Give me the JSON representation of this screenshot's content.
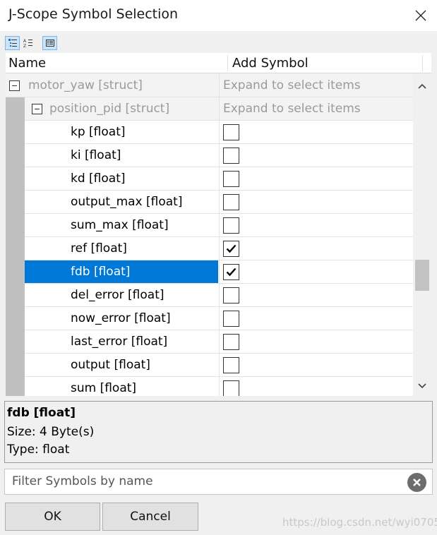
{
  "window": {
    "title": "J-Scope Symbol Selection"
  },
  "toolbar": {
    "buttons": [
      {
        "name": "categorized-view",
        "icon": "list-categorized-icon",
        "active": true
      },
      {
        "name": "sorted-view",
        "icon": "sort-az-icon",
        "active": false
      },
      {
        "name": "details-view",
        "icon": "details-pane-icon",
        "active": true
      }
    ]
  },
  "columns": {
    "name": "Name",
    "add": "Add Symbol"
  },
  "tree": {
    "rows": [
      {
        "label": "motor_yaw [struct]",
        "add_text": "Expand to select items",
        "expandable": true,
        "level": 0
      },
      {
        "label": "position_pid [struct]",
        "add_text": "Expand to select items",
        "expandable": true,
        "level": 1
      },
      {
        "label": "kp [float]",
        "checked": false,
        "level": 2
      },
      {
        "label": "ki [float]",
        "checked": false,
        "level": 2
      },
      {
        "label": "kd [float]",
        "checked": false,
        "level": 2
      },
      {
        "label": "output_max [float]",
        "checked": false,
        "level": 2
      },
      {
        "label": "sum_max [float]",
        "checked": false,
        "level": 2
      },
      {
        "label": "ref [float]",
        "checked": true,
        "level": 2
      },
      {
        "label": "fdb [float]",
        "checked": true,
        "level": 2,
        "selected": true
      },
      {
        "label": "del_error [float]",
        "checked": false,
        "level": 2
      },
      {
        "label": "now_error [float]",
        "checked": false,
        "level": 2
      },
      {
        "label": "last_error [float]",
        "checked": false,
        "level": 2
      },
      {
        "label": "output [float]",
        "checked": false,
        "level": 2
      },
      {
        "label": "sum [float]",
        "checked": false,
        "level": 2
      }
    ]
  },
  "info": {
    "title": "fdb [float]",
    "size": "Size:  4 Byte(s)",
    "type": "Type:  float"
  },
  "filter": {
    "placeholder": "Filter Symbols by name"
  },
  "buttons": {
    "ok": "OK",
    "cancel": "Cancel"
  },
  "watermark": "https://blog.csdn.net/wyi0705",
  "colors": {
    "selection": "#0078d7",
    "gutter": "#c0c0c0"
  }
}
